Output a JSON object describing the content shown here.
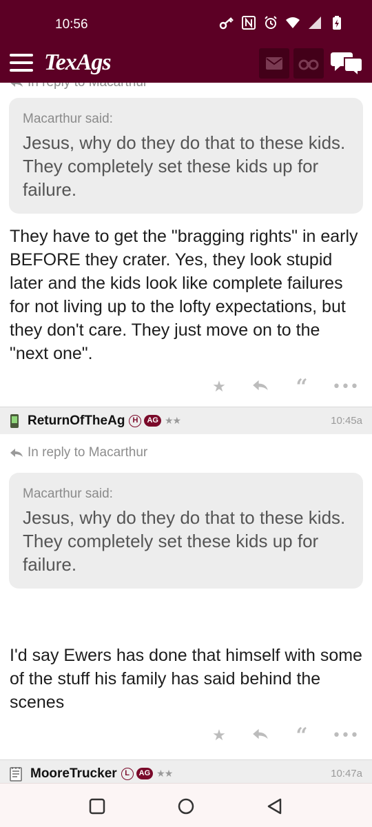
{
  "status_bar": {
    "time": "10:56"
  },
  "app_bar": {
    "brand": "TexAgs"
  },
  "posts": [
    {
      "reply_to": "In reply to Macarthur",
      "quote_author": "Macarthur said:",
      "quote_text": "Jesus, why do they do that to these kids. They completely set these kids up for failure.",
      "body": "They have to get the \"bragging rights\" in early BEFORE they crater. Yes, they look stupid later and the kids look like complete failures for not living up to the lofty expectations, but they don't care. They just move on to the \"next one\"."
    },
    {
      "author": "ReturnOfTheAg",
      "badge_letter": "H",
      "badge_ag": "AG",
      "stars": "★★",
      "time": "10:45a",
      "reply_to": "In reply to Macarthur",
      "quote_author": "Macarthur said:",
      "quote_text": "Jesus, why do they do that to these kids. They completely set these kids up for failure.",
      "body": "I'd say Ewers has done that himself with some of the stuff his family has said behind the scenes"
    },
    {
      "author": "MooreTrucker",
      "badge_letter": "L",
      "badge_ag": "AG",
      "stars": "★★",
      "time": "10:47a"
    }
  ],
  "colors": {
    "brand_maroon": "#5c0025",
    "badge_maroon": "#7a0a2a",
    "quote_bg": "#ededed"
  }
}
